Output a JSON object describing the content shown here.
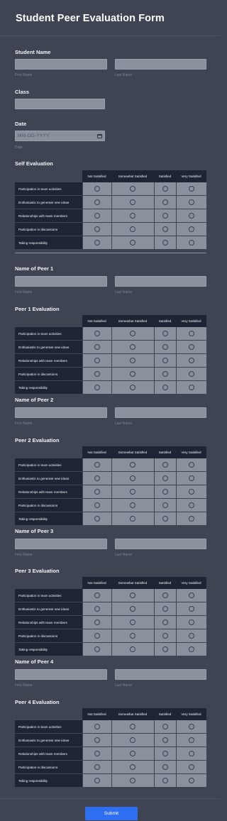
{
  "form": {
    "title": "Student Peer Evaluation Form",
    "submit_label": "Submit"
  },
  "student_name": {
    "label": "Student Name",
    "first": "First Name",
    "last": "Last Name"
  },
  "class_field": {
    "label": "Class"
  },
  "date_field": {
    "label": "Date",
    "placeholder": "MM-DD-YYYY",
    "sublabel": "Date"
  },
  "columns": [
    "Not Satisfied",
    "Somewhat Satisfied",
    "Satisfied",
    "Very Satisfied"
  ],
  "criteria": [
    "Participation in team activities",
    "Enthusiastic to generate new ideas",
    "Relationships with team members",
    "Participation in discussions",
    "Taking responsibility"
  ],
  "self_eval": {
    "label": "Self Evaluation"
  },
  "peers": [
    {
      "name_label": "Name of Peer 1",
      "eval_label": "Peer 1 Evaluation",
      "first": "First Name",
      "last": "Last Name"
    },
    {
      "name_label": "Name of Peer 2",
      "eval_label": "Peer 2 Evaluation",
      "first": "First Name",
      "last": "Last Name"
    },
    {
      "name_label": "Name of Peer 3",
      "eval_label": "Peer 3 Evaluation",
      "first": "First Name",
      "last": "Last Name"
    },
    {
      "name_label": "Name of Peer 4",
      "eval_label": "Peer 4 Evaluation",
      "first": "First Name",
      "last": "Last Name"
    }
  ]
}
